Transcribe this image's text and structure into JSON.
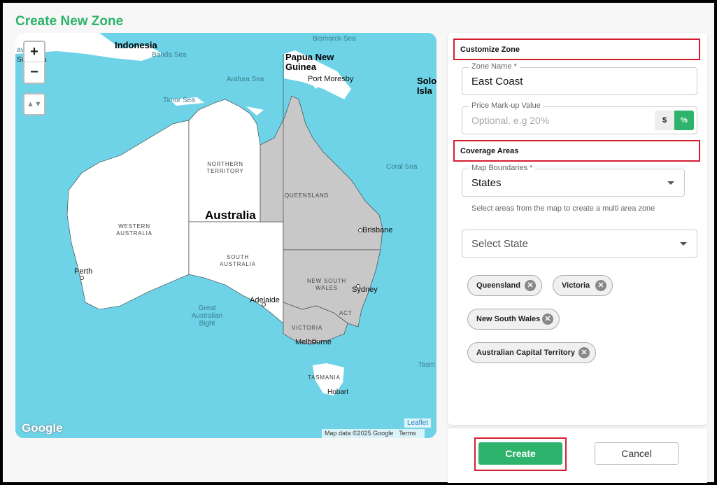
{
  "page": {
    "title": "Create New Zone"
  },
  "map": {
    "zoom_in": "+",
    "zoom_out": "−",
    "tilt": "▲▼",
    "labels": {
      "java_sea": "ava Sea",
      "surabaya": "Surabaya",
      "indonesia": "Indonesia",
      "banda_sea": "Banda Sea",
      "bismarck_sea": "Bismarck Sea",
      "papua_new_guinea": "Papua New Guinea",
      "port_moresby": "Port Moresby",
      "solomon": "Solo Isla",
      "arafura_sea": "Arafura Sea",
      "timor_sea": "Timor Sea",
      "coral_sea": "Coral Sea",
      "northern_territory": "NORTHERN TERRITORY",
      "queensland": "QUEENSLAND",
      "australia": "Australia",
      "western_australia": "WESTERN AUSTRALIA",
      "south_australia": "SOUTH AUSTRALIA",
      "brisbane": "Brisbane",
      "perth": "Perth",
      "new_south_wales": "NEW SOUTH WALES",
      "sydney": "Sydney",
      "adelaide": "Adelaide",
      "act": "ACT",
      "great_australian_bight": "Great Australian Bight",
      "victoria": "VICTORIA",
      "melbourne": "Melbourne",
      "tasmania": "TASMANIA",
      "hobart": "Hobart",
      "tasman": "Tasm"
    },
    "google": "Google",
    "map_data": "Map data ©2025 Google",
    "terms": "Terms",
    "leaflet": "Leaflet"
  },
  "panel": {
    "customize_heading": "Customize Zone",
    "zone_name": {
      "label": "Zone Name *",
      "value": "East Coast"
    },
    "price_markup": {
      "label": "Price Mark-up Value",
      "placeholder": "Optional. e.g 20%",
      "opt_dollar": "$",
      "opt_percent": "%"
    },
    "coverage_heading": "Coverage Areas",
    "map_boundaries": {
      "label": "Map Boundaries *",
      "value": "States"
    },
    "help_text": "Select areas from the map to create a multi area zone",
    "select_state": {
      "placeholder": "Select State"
    },
    "chips": [
      "Queensland",
      "Victoria",
      "New South Wales",
      "Australian Capital Territory"
    ],
    "chip_remove": "✕"
  },
  "footer": {
    "create": "Create",
    "cancel": "Cancel"
  },
  "colors": {
    "accent": "#2db36b",
    "highlight": "#d32030",
    "sea": "#6fd3e7",
    "selected_state": "#c8c8c8"
  }
}
